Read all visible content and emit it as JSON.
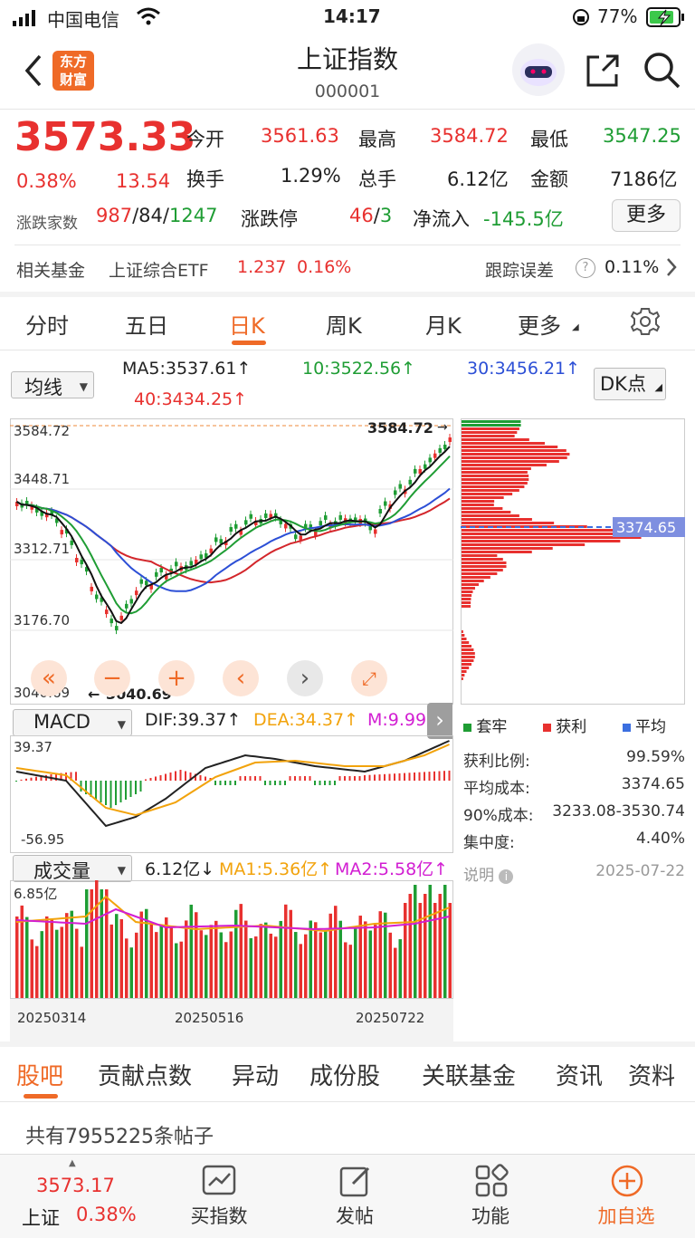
{
  "status": {
    "carrier": "中国电信",
    "time": "14:17",
    "battery": "77%"
  },
  "header": {
    "title": "上证指数",
    "code": "000001",
    "logo_line1": "东方",
    "logo_line2": "财富"
  },
  "quote": {
    "price": "3573.33",
    "change_pct": "0.38%",
    "change": "13.54",
    "open_label": "今开",
    "open": "3561.63",
    "high_label": "最高",
    "high": "3584.72",
    "low_label": "最低",
    "low": "3547.25",
    "turnover_label": "换手",
    "turnover": "1.29%",
    "volume_label": "总手",
    "volume": "6.12亿",
    "amount_label": "金额",
    "amount": "7186亿",
    "breadth_label": "涨跌家数",
    "breadth_up": "987",
    "breadth_flat": "84",
    "breadth_down": "1247",
    "limit_label": "涨跌停",
    "limit_up": "46",
    "limit_down": "3",
    "netflow_label": "净流入",
    "netflow": "-145.5亿",
    "more_button": "更多"
  },
  "fund": {
    "label": "相关基金",
    "name": "上证综合ETF",
    "price": "1.237",
    "pct": "0.16%",
    "error_label": "跟踪误差",
    "error": "0.11%"
  },
  "tabs": [
    "分时",
    "五日",
    "日K",
    "周K",
    "月K",
    "更多"
  ],
  "ma": {
    "selector": "均线",
    "ma5": "MA5:3537.61↑",
    "ma10": "10:3522.56↑",
    "ma30": "30:3456.21↑",
    "ma40": "40:3434.25↑",
    "dk": "DK点"
  },
  "kline": {
    "y_ticks": [
      "3584.72",
      "3448.71",
      "3312.71",
      "3176.70",
      "3040.69"
    ],
    "high_marker": "3584.72",
    "low_marker": "3040.69",
    "cost_marker": "3374.65"
  },
  "macd": {
    "selector": "MACD",
    "dif": "DIF:39.37↑",
    "dea": "DEA:34.37↑",
    "m": "M:9.99↑",
    "y_top": "39.37",
    "y_bottom": "-56.95"
  },
  "volume": {
    "selector": "成交量",
    "current": "6.12亿↓",
    "ma1": "MA1:5.36亿↑",
    "ma2": "MA2:5.58亿↑",
    "y_top": "6.85亿",
    "dates": [
      "20250314",
      "20250516",
      "20250722"
    ]
  },
  "chip": {
    "legend_trapped": "套牢",
    "legend_profit": "获利",
    "legend_avg": "平均",
    "profit_ratio_label": "获利比例:",
    "profit_ratio": "99.59%",
    "avg_cost_label": "平均成本:",
    "avg_cost": "3374.65",
    "cost90_label": "90%成本:",
    "cost90": "3233.08-3530.74",
    "concentration_label": "集中度:",
    "concentration": "4.40%",
    "note_label": "说明",
    "date": "2025-07-22"
  },
  "bottom_tabs": [
    "股吧",
    "贡献点数",
    "异动",
    "成份股",
    "关联基金",
    "资讯",
    "资料"
  ],
  "posts": "共有7955225条帖子",
  "nav": {
    "price": "3573.17",
    "name": "上证",
    "pct": "0.38%",
    "buy": "买指数",
    "post": "发帖",
    "func": "功能",
    "add": "加自选"
  },
  "colors": {
    "up": "#e8312f",
    "down": "#1f9d34",
    "accent": "#ef6a27",
    "ma5": "#111111",
    "ma10": "#1f9d34",
    "ma30": "#2c4fd6",
    "ma40": "#d3262b"
  }
}
